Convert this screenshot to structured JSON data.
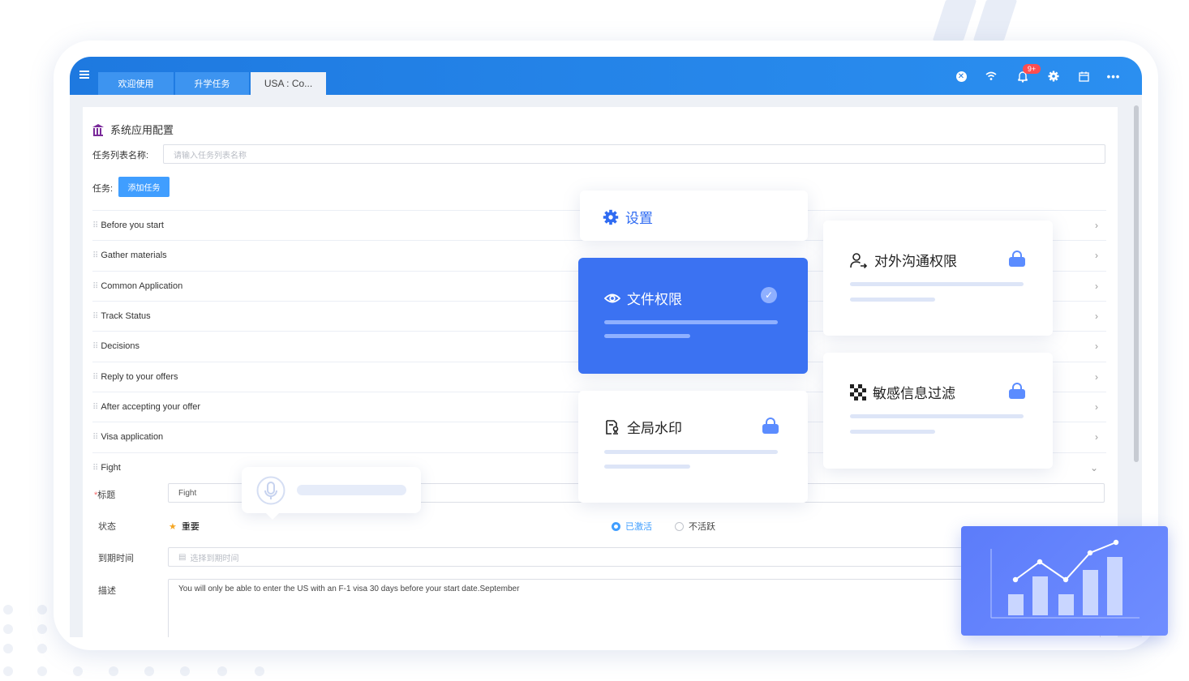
{
  "tabs": [
    {
      "label": "欢迎使用"
    },
    {
      "label": "升学任务"
    },
    {
      "label": "USA : Co..."
    }
  ],
  "topbar": {
    "notification_badge": "9+",
    "icons": [
      "close-circle-icon",
      "wifi-icon",
      "bell-icon",
      "gear-icon",
      "calendar-icon",
      "more-icon"
    ]
  },
  "section": {
    "title": "系统应用配置"
  },
  "form": {
    "task_list_name_label": "任务列表名称:",
    "task_list_name_placeholder": "请输入任务列表名称",
    "task_label": "任务:",
    "add_task_button": "添加任务"
  },
  "tasks": [
    "Before you start",
    "Gather materials",
    "Common Application",
    "Track Status",
    "Decisions",
    "Reply to your offers",
    "After accepting your offer",
    "Visa application",
    "Fight"
  ],
  "expanded_task": {
    "title_label": "标题",
    "title_value": "Fight",
    "status_label": "状态",
    "important_label": "重要",
    "radio_active": "已激活",
    "radio_inactive": "不活跃",
    "due_label": "到期时间",
    "due_placeholder": "选择到期时间",
    "desc_label": "描述",
    "desc_value": "You will only be able to enter the US with an F-1 visa 30 days before your start date.September"
  },
  "cards": {
    "settings": "设置",
    "file_permission": "文件权限",
    "global_watermark": "全局水印",
    "external_comm": "对外沟通权限",
    "sensitive_filter": "敏感信息过滤"
  },
  "colors": {
    "topbar": "#1e79e0",
    "accent": "#409eff",
    "card_blue": "#3b72f2",
    "lock": "#5b8cff"
  }
}
